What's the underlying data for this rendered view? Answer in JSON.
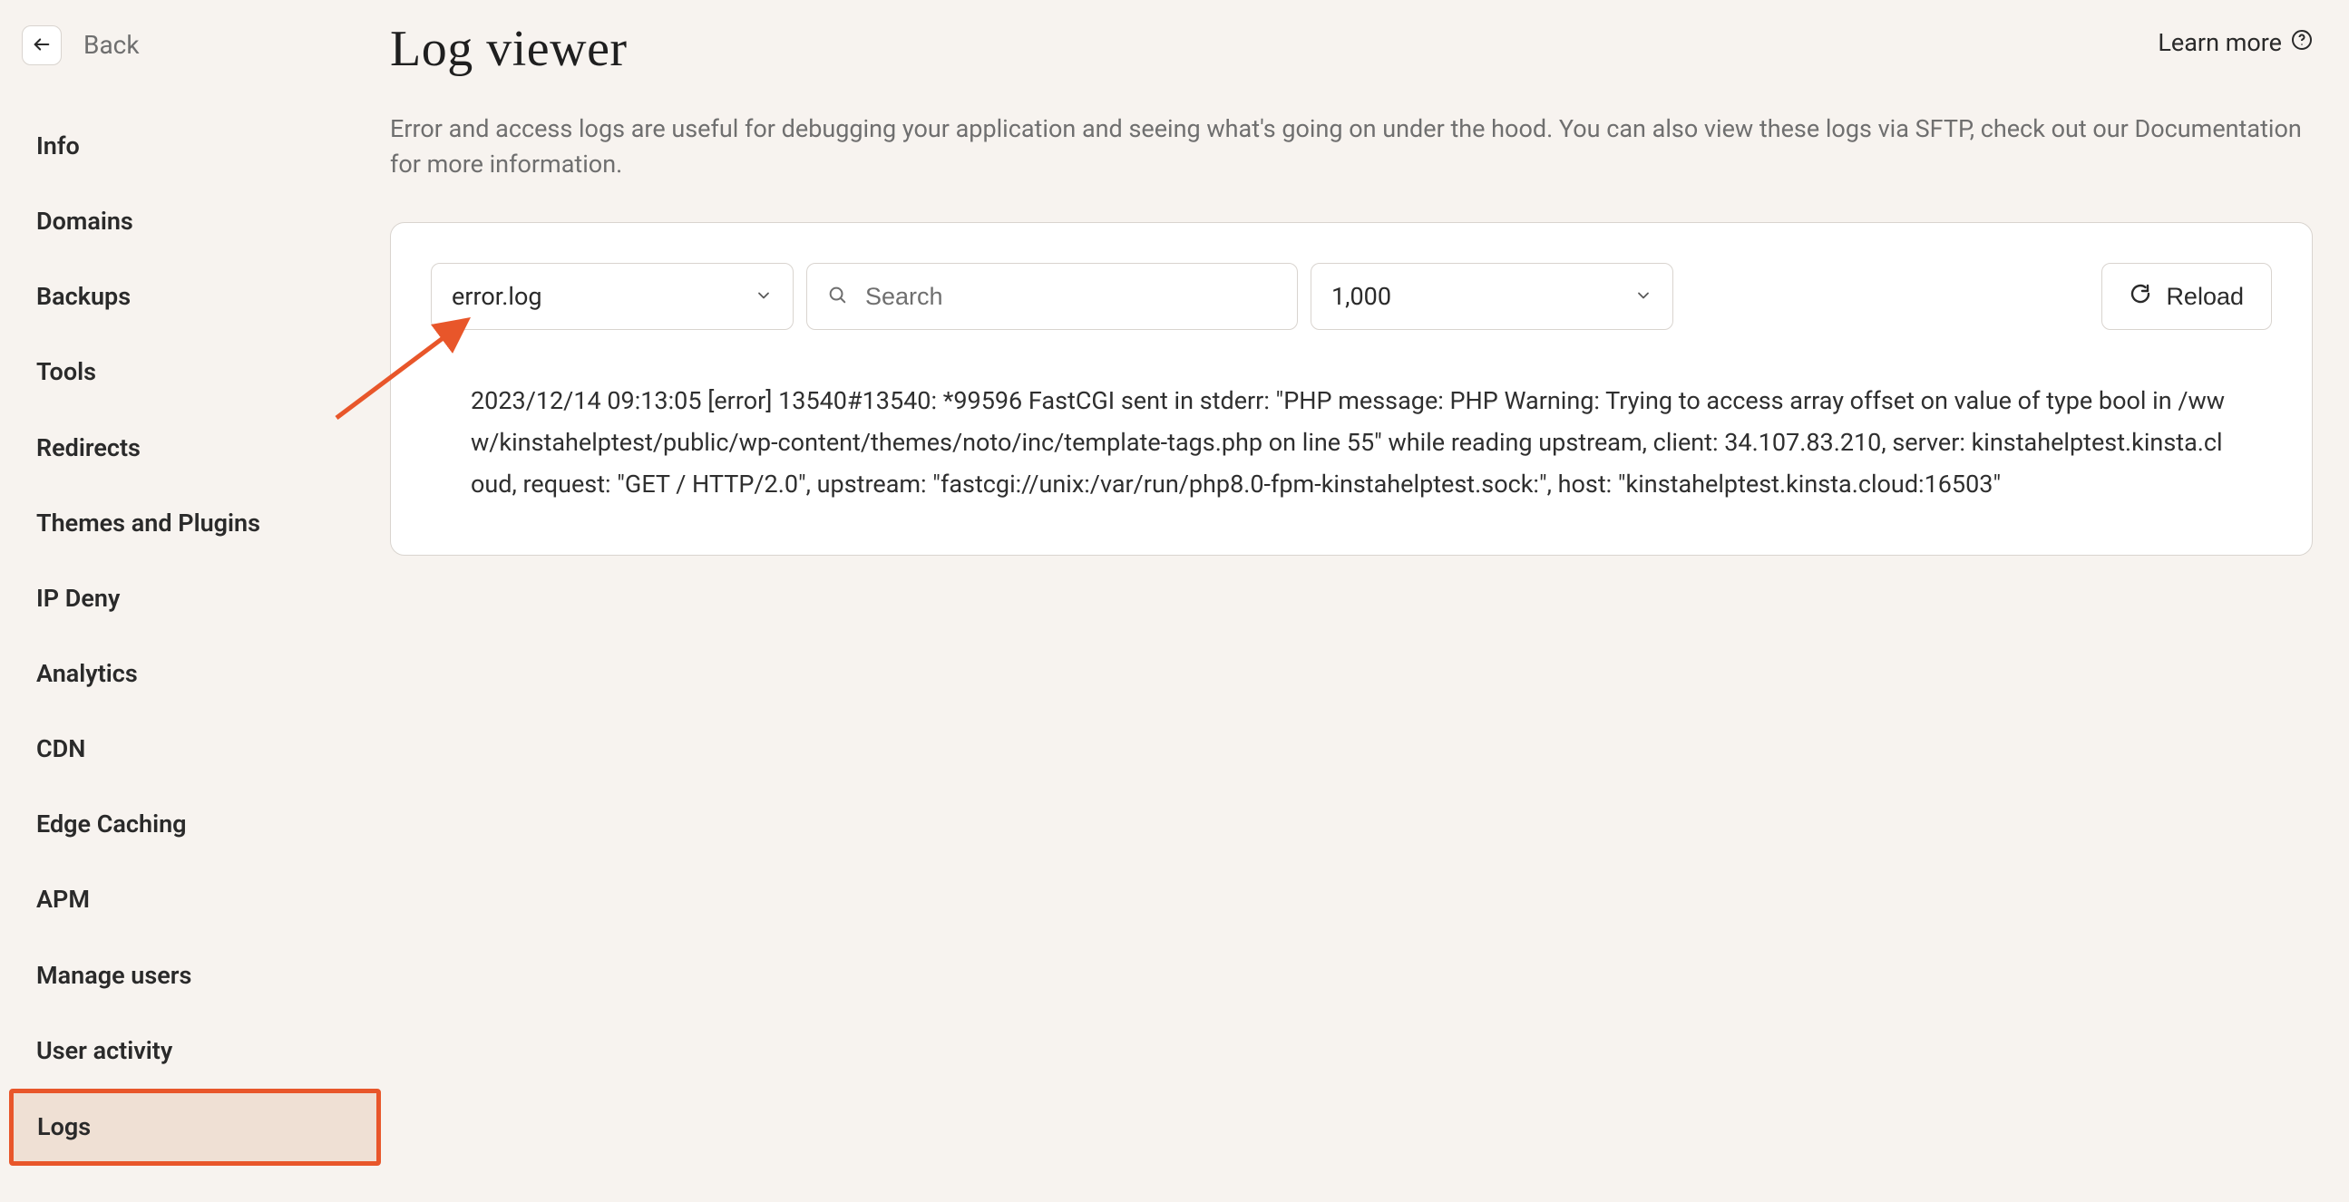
{
  "sidebar": {
    "back_label": "Back",
    "items": [
      {
        "label": "Info"
      },
      {
        "label": "Domains"
      },
      {
        "label": "Backups"
      },
      {
        "label": "Tools"
      },
      {
        "label": "Redirects"
      },
      {
        "label": "Themes and Plugins"
      },
      {
        "label": "IP Deny"
      },
      {
        "label": "Analytics"
      },
      {
        "label": "CDN"
      },
      {
        "label": "Edge Caching"
      },
      {
        "label": "APM"
      },
      {
        "label": "Manage users"
      },
      {
        "label": "User activity"
      },
      {
        "label": "Logs"
      }
    ],
    "active_index": 13
  },
  "header": {
    "title": "Log viewer",
    "learn_more": "Learn more"
  },
  "description": "Error and access logs are useful for debugging your application and seeing what's going on under the hood. You can also view these logs via SFTP, check out our Documentation for more information.",
  "controls": {
    "log_file_selected": "error.log",
    "search_placeholder": "Search",
    "lines_selected": "1,000",
    "reload_label": "Reload"
  },
  "log": {
    "entries": [
      "2023/12/14 09:13:05 [error] 13540#13540: *99596 FastCGI sent in stderr: \"PHP message: PHP Warning: Trying to access array offset on value of type bool in /www/kinstahelptest/public/wp-content/themes/noto/inc/template-tags.php on line 55\" while reading upstream, client: 34.107.83.210, server: kinstahelptest.kinsta.cloud, request: \"GET / HTTP/2.0\", upstream: \"fastcgi://unix:/var/run/php8.0-fpm-kinstahelptest.sock:\", host: \"kinstahelptest.kinsta.cloud:16503\""
    ]
  }
}
